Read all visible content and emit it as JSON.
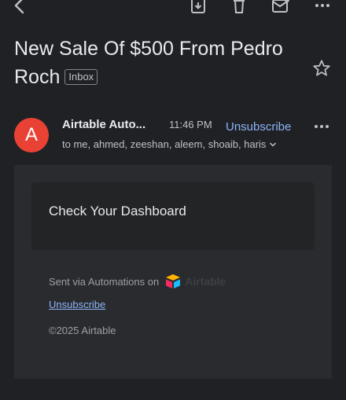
{
  "toolbar": {
    "back_icon": "back-arrow-icon",
    "archive_icon": "archive-icon",
    "delete_icon": "trash-icon",
    "mark_unread_icon": "mark-unread-icon",
    "more_icon": "more-vertical-icon"
  },
  "email": {
    "subject": "New Sale Of $500 From Pedro Roch",
    "label_chip": "Inbox",
    "sender_initial": "A",
    "sender_name": "Airtable Auto...",
    "time": "11:46 PM",
    "unsubscribe_link": "Unsubscribe",
    "recipients": "to me, ahmed, zeeshan, aleem, shoaib, haris"
  },
  "body": {
    "card_text": "Check Your Dashboard",
    "sent_via": "Sent via Automations on",
    "brand_name": "Airtable",
    "unsubscribe_link": "Unsubscribe",
    "copyright": "©2025 Airtable"
  },
  "colors": {
    "background": "#202124",
    "avatar": "#e94235",
    "link": "#8ab4f8"
  }
}
